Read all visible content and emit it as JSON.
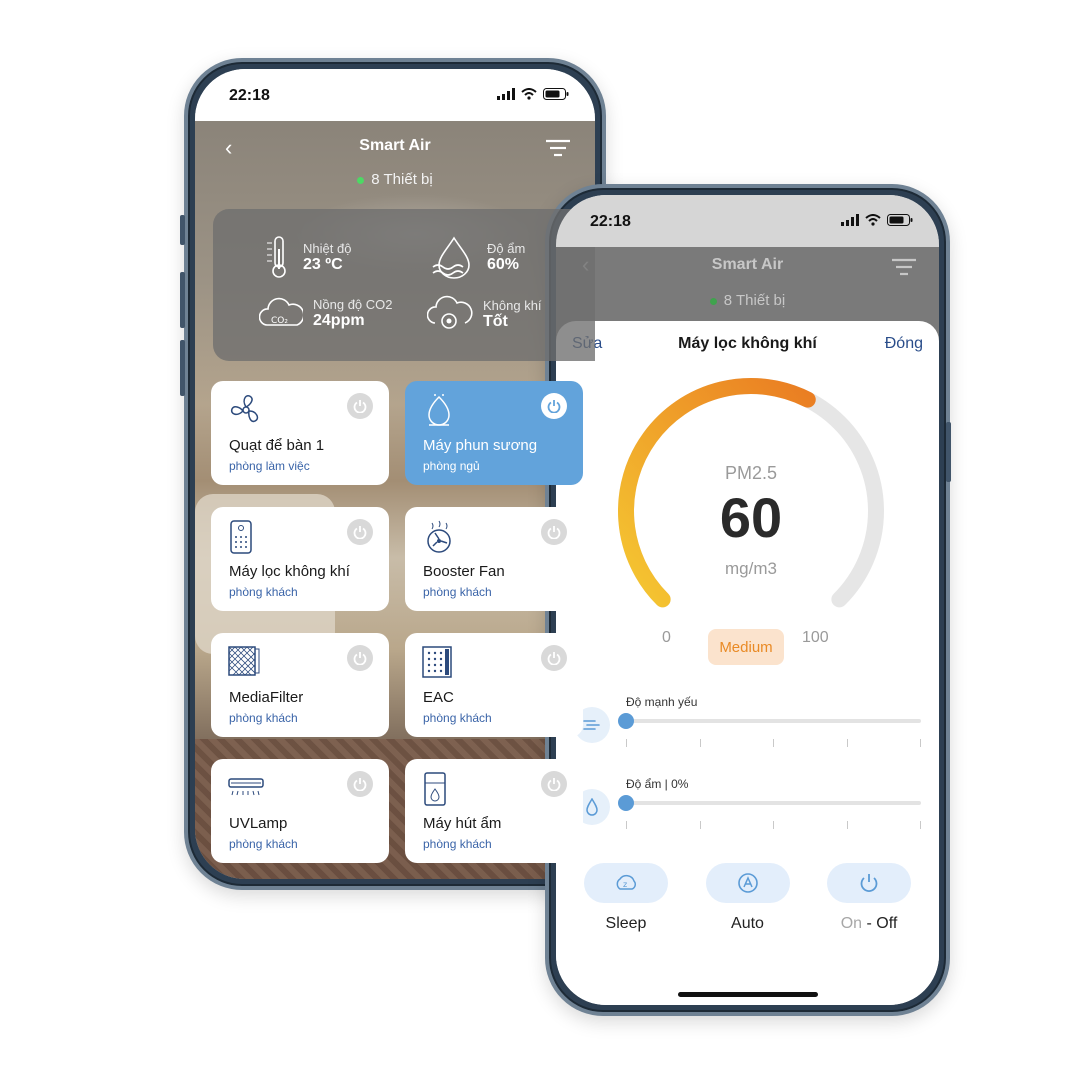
{
  "back_phone": {
    "status": {
      "time": "22:18"
    },
    "nav": {
      "back_glyph": "‹",
      "title": "Smart Air",
      "device_count": "8 Thiết bị"
    },
    "env": [
      {
        "label": "Nhiệt độ",
        "value": "23 ºC",
        "icon": "thermometer-icon"
      },
      {
        "label": "Độ ẩm",
        "value": "60%",
        "icon": "humidity-icon"
      },
      {
        "label": "Nồng độ CO2",
        "value": "24ppm",
        "icon": "co2-cloud-icon"
      },
      {
        "label": "Không khí",
        "value": "Tốt",
        "icon": "air-quality-icon"
      }
    ],
    "devices": [
      {
        "name": "Quạt để bàn 1",
        "room": "phòng làm việc",
        "icon": "fan-icon",
        "active": false
      },
      {
        "name": "Máy phun sương",
        "room": "phòng ngủ",
        "icon": "mist-sprayer-icon",
        "active": true
      },
      {
        "name": "Máy lọc không khí",
        "room": "phòng khách",
        "icon": "air-purifier-icon",
        "active": false
      },
      {
        "name": "Booster Fan",
        "room": "phòng khách",
        "icon": "booster-fan-icon",
        "active": false
      },
      {
        "name": "MediaFilter",
        "room": "phòng khách",
        "icon": "media-filter-icon",
        "active": false
      },
      {
        "name": "EAC",
        "room": "phòng khách",
        "icon": "eac-icon",
        "active": false
      },
      {
        "name": "UVLamp",
        "room": "phòng khách",
        "icon": "uv-lamp-icon",
        "active": false
      },
      {
        "name": "Máy hút ẩm",
        "room": "phòng khách",
        "icon": "dehumidifier-icon",
        "active": false
      }
    ]
  },
  "front_phone": {
    "status": {
      "time": "22:18"
    },
    "nav": {
      "back_glyph": "‹",
      "title": "Smart Air",
      "device_count": "8 Thiết bị"
    },
    "sheet": {
      "edit": "Sửa",
      "title": "Máy lọc không khí",
      "close": "Đóng"
    },
    "gauge": {
      "metric": "PM2.5",
      "value": "60",
      "unit": "mg/m3",
      "min": "0",
      "max": "100",
      "level": "Medium",
      "fraction": 0.6,
      "colors": {
        "start": "#f5c832",
        "end": "#ea7d22",
        "track": "#e6e6e6",
        "badge_bg": "#fbe3cd",
        "badge_text": "#e98a25"
      }
    },
    "sliders": [
      {
        "label": "Độ mạnh yếu",
        "icon": "wind-icon",
        "value_fraction": 0.0
      },
      {
        "label": "Độ ẩm | 0%",
        "icon": "droplet-icon",
        "value_fraction": 0.0
      }
    ],
    "modes": [
      {
        "label": "Sleep",
        "icon": "sleep-icon"
      },
      {
        "label": "Auto",
        "icon": "auto-icon"
      },
      {
        "label_on": "On",
        "label_off": " - Off",
        "icon": "power-icon"
      }
    ]
  },
  "colors": {
    "accent_blue": "#62a3db",
    "link_blue": "#2a4d8a",
    "online_green": "#4cd964"
  }
}
